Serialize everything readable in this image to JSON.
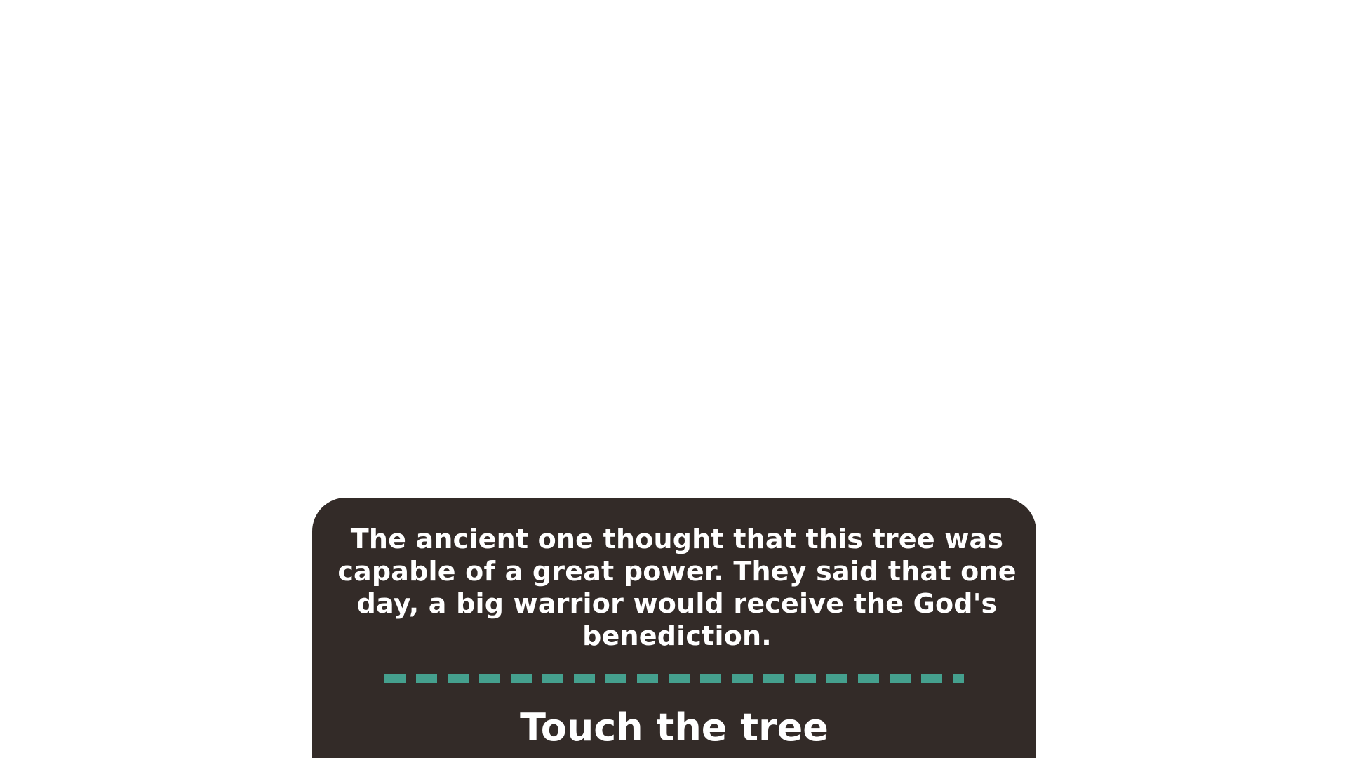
{
  "dialog": {
    "text": "The ancient one thought that this tree was capable of a great power. They said that one day, a big warrior would receive the God's benediction.",
    "choice_label": "Touch the tree"
  },
  "colors": {
    "panel_background": "#332b28",
    "divider_accent": "#45a08e",
    "text": "#ffffff"
  }
}
